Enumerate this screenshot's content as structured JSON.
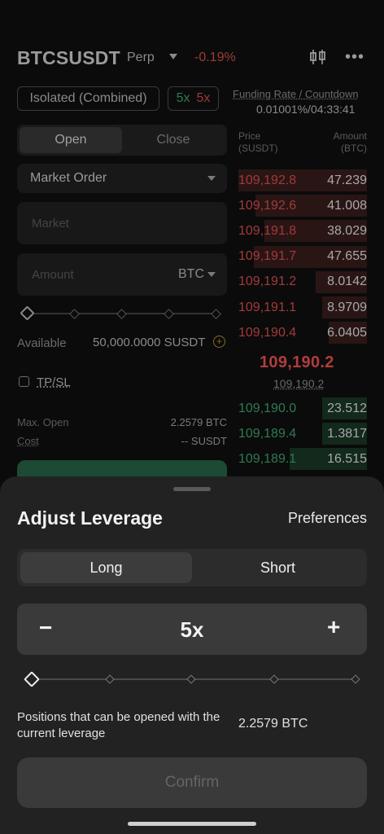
{
  "header": {
    "symbol": "BTCSUSDT",
    "type": "Perp",
    "change": "-0.19%",
    "icons": [
      "candlestick-chart-icon",
      "more-icon"
    ]
  },
  "trade_bar": {
    "margin_mode": "Isolated (Combined)",
    "long_leverage": "5x",
    "short_leverage": "5x",
    "funding_label": "Funding Rate / Countdown",
    "funding_value": "0.01001%/04:33:41"
  },
  "order_form": {
    "tabs": [
      "Open",
      "Close"
    ],
    "order_type": "Market Order",
    "market_placeholder": "Market",
    "amount_placeholder": "Amount",
    "amount_unit": "BTC",
    "available_label": "Available",
    "available_value": "50,000.0000 SUSDT",
    "tpsl_label": "TP/SL",
    "max_open_label": "Max. Open",
    "max_open_value": "2.2579 BTC",
    "cost_label": "Cost",
    "cost_value": "-- SUSDT"
  },
  "order_book": {
    "price_header": "Price\n(SUSDT)",
    "amount_header": "Amount\n(BTC)",
    "asks": [
      {
        "price": "109,192.8",
        "amount": "47.239",
        "depth": 1.0
      },
      {
        "price": "109,192.6",
        "amount": "41.008",
        "depth": 0.87
      },
      {
        "price": "109,191.8",
        "amount": "38.029",
        "depth": 0.8
      },
      {
        "price": "109,191.7",
        "amount": "47.655",
        "depth": 0.88
      },
      {
        "price": "109,191.2",
        "amount": "8.0142",
        "depth": 0.4
      },
      {
        "price": "109,191.1",
        "amount": "8.9709",
        "depth": 0.35
      },
      {
        "price": "109,190.4",
        "amount": "6.0405",
        "depth": 0.3
      }
    ],
    "last_price": "109,190.2",
    "mark_price": "109,190.2",
    "bids": [
      {
        "price": "109,190.0",
        "amount": "23.512",
        "depth": 0.35
      },
      {
        "price": "109,189.4",
        "amount": "1.3817",
        "depth": 0.35
      },
      {
        "price": "109,189.1",
        "amount": "16.515",
        "depth": 0.6
      }
    ]
  },
  "sheet": {
    "title": "Adjust Leverage",
    "preferences": "Preferences",
    "tabs": [
      "Long",
      "Short"
    ],
    "active_tab": "Long",
    "minus": "−",
    "leverage": "5x",
    "plus": "+",
    "positions_label": "Positions that can be opened with the current leverage",
    "positions_value": "2.2579 BTC",
    "confirm": "Confirm"
  },
  "colors": {
    "ask": "#a23a3a",
    "bid": "#2f7a52",
    "sheet_bg": "#222222"
  }
}
